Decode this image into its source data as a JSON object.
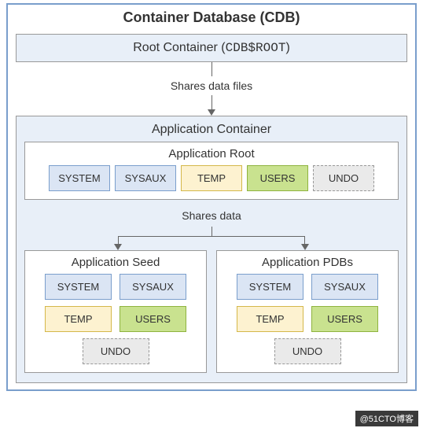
{
  "cdb": {
    "title": "Container Database (CDB)",
    "root": {
      "label": "Root Container (",
      "code": "CDB$ROOT",
      "close": ")"
    },
    "connector1": "Shares data files",
    "appContainer": {
      "title": "Application Container",
      "appRoot": {
        "title": "Application Root"
      },
      "tablespaces": {
        "system": "SYSTEM",
        "sysaux": "SYSAUX",
        "temp": "TEMP",
        "users": "USERS",
        "undo": "UNDO"
      },
      "sharesData": "Shares data",
      "seed": {
        "title": "Application Seed"
      },
      "pdbs": {
        "title": "Application PDBs"
      }
    }
  },
  "watermark": "@51CTO博客"
}
